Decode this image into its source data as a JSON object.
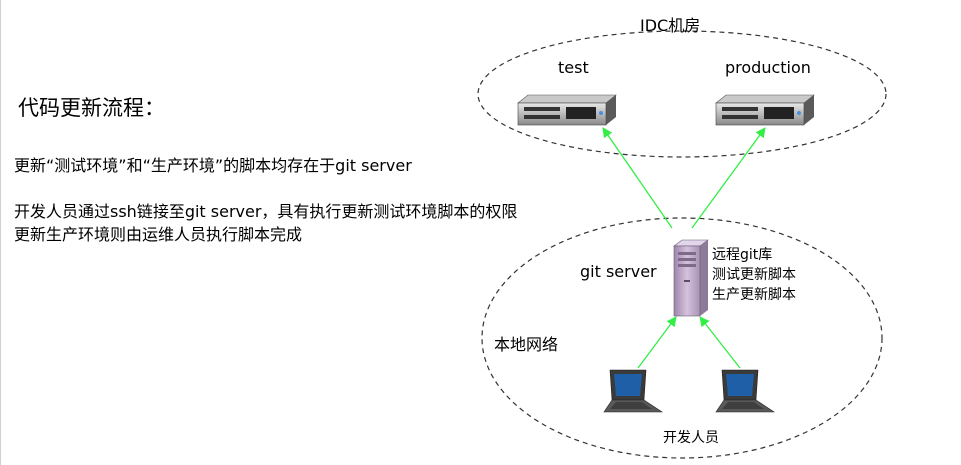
{
  "title": "代码更新流程：",
  "notes": [
    "更新“测试环境”和“生产环境”的脚本均存在于git server",
    "开发人员通过ssh链接至git server，具有执行更新测试环境脚本的权限",
    "更新生产环境则由运维人员执行脚本完成"
  ],
  "idc": {
    "label": "IDC机房",
    "test_label": "test",
    "production_label": "production"
  },
  "local_net": {
    "label": "本地网络",
    "git_server_label": "git server",
    "repo_items": [
      "远程git库",
      "测试更新脚本",
      "生产更新脚本"
    ],
    "developers_label": "开发人员"
  },
  "colors": {
    "arrow": "#33ee44",
    "server_body": "#505050",
    "tower": "#c8b4d2",
    "ellipse_stroke": "#333333"
  },
  "icons": [
    "rack-server-icon",
    "rack-server-icon",
    "tower-server-icon",
    "laptop-icon",
    "laptop-icon"
  ]
}
